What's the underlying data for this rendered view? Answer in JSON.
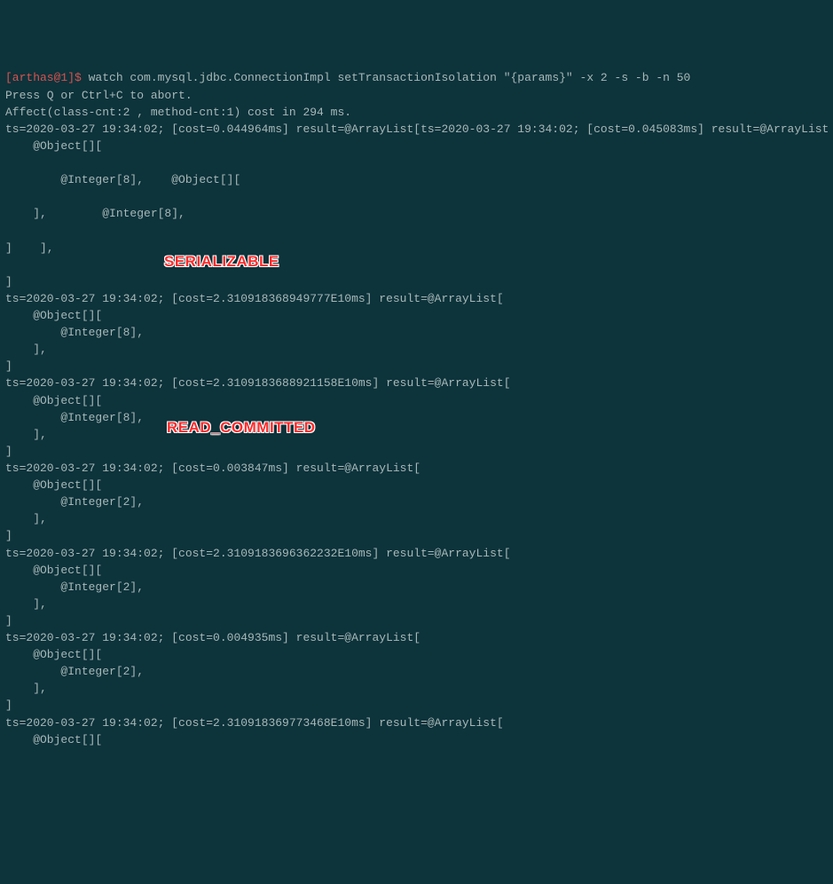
{
  "prompt": {
    "user_host": "[arthas@1]$",
    "command": " watch com.mysql.jdbc.ConnectionImpl setTransactionIsolation \"{params}\" -x 2 -s -b -n 50"
  },
  "lines": [
    "Press Q or Ctrl+C to abort.",
    "Affect(class-cnt:2 , method-cnt:1) cost in 294 ms.",
    "ts=2020-03-27 19:34:02; [cost=0.044964ms] result=@ArrayList[ts=2020-03-27 19:34:02; [cost=0.045083ms] result=@ArrayList",
    "    @Object[][",
    "",
    "        @Integer[8],    @Object[][",
    "",
    "    ],        @Integer[8],",
    "",
    "]    ],",
    "",
    "]",
    "ts=2020-03-27 19:34:02; [cost=2.310918368949777E10ms] result=@ArrayList[",
    "    @Object[][",
    "        @Integer[8],",
    "    ],",
    "]",
    "ts=2020-03-27 19:34:02; [cost=2.3109183688921158E10ms] result=@ArrayList[",
    "    @Object[][",
    "        @Integer[8],",
    "    ],",
    "]",
    "ts=2020-03-27 19:34:02; [cost=0.003847ms] result=@ArrayList[",
    "    @Object[][",
    "        @Integer[2],",
    "    ],",
    "]",
    "ts=2020-03-27 19:34:02; [cost=2.3109183696362232E10ms] result=@ArrayList[",
    "    @Object[][",
    "        @Integer[2],",
    "    ],",
    "]",
    "ts=2020-03-27 19:34:02; [cost=0.004935ms] result=@ArrayList[",
    "    @Object[][",
    "        @Integer[2],",
    "    ],",
    "]",
    "ts=2020-03-27 19:34:02; [cost=2.310918369773468E10ms] result=@ArrayList[",
    "    @Object[]["
  ],
  "annotations": {
    "serializable": "SERIALIZABLE",
    "read_committed": "READ_COMMITTED"
  }
}
